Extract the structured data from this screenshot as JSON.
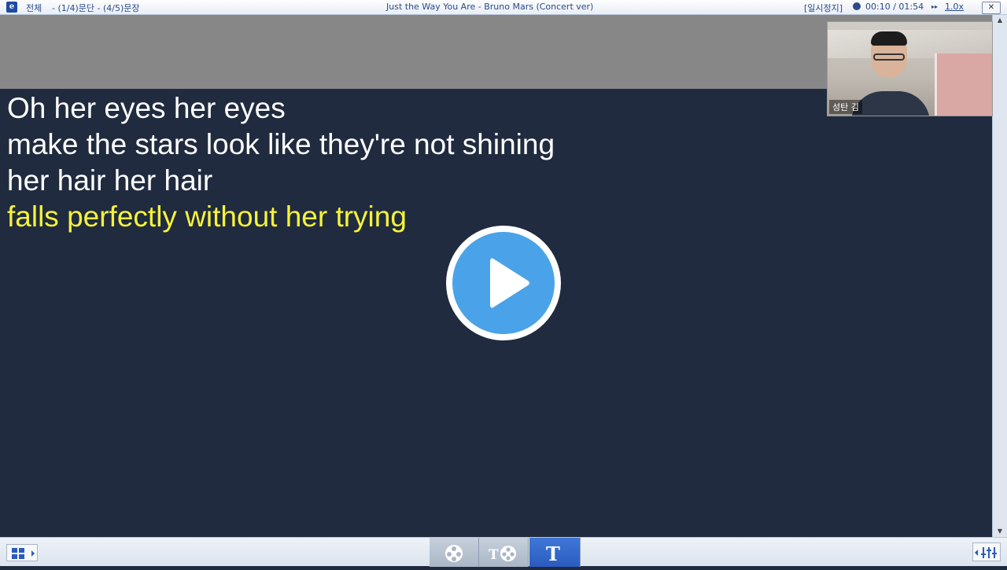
{
  "titlebar": {
    "scope": "전체",
    "position": "- (1/4)문단 - (4/5)문장",
    "song_title": "Just the Way You Are - Bruno Mars (Concert ver)",
    "status": "[일시정지]",
    "time": "00:10 / 01:54",
    "speed": "1.0x",
    "close_glyph": "✕"
  },
  "lyrics": [
    {
      "text": "Oh her eyes her eyes",
      "active": false
    },
    {
      "text": "make the stars look like they're not shining",
      "active": false
    },
    {
      "text": "her hair her hair",
      "active": false
    },
    {
      "text": "falls perfectly without her trying",
      "active": true
    }
  ],
  "webcam": {
    "name": "성탄 김"
  },
  "bottom": {
    "mode_text_only_label": "T"
  },
  "colors": {
    "lyrics_bg": "#202b3f",
    "active_lyric": "#f6f338",
    "play_button": "#4aa3e8"
  }
}
